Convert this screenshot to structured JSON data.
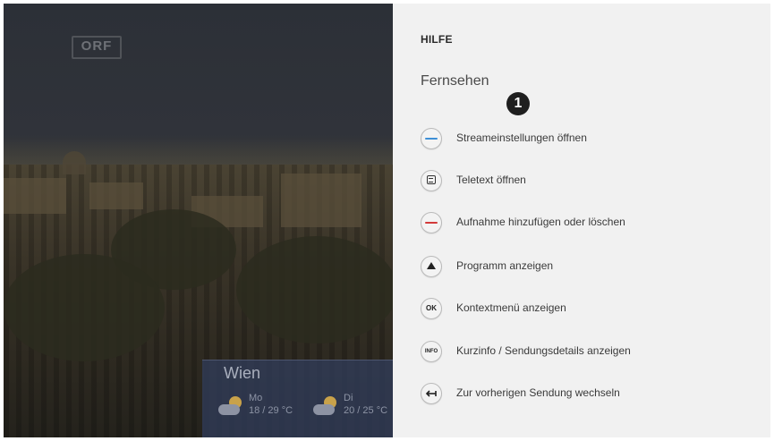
{
  "video": {
    "channel_logo": "ORF",
    "weather": {
      "city": "Wien",
      "forecast": [
        {
          "day": "Mo",
          "temp": "18 / 29 °C",
          "icon": "partly-cloudy-icon"
        },
        {
          "day": "Di",
          "temp": "20 / 25 °C",
          "icon": "partly-cloudy-icon"
        }
      ]
    }
  },
  "help_panel": {
    "title": "HILFE",
    "section": "Fernsehen",
    "marker": "1",
    "items": [
      {
        "icon": "blue-button-icon",
        "label": "Streameinstellungen öffnen"
      },
      {
        "icon": "teletext-icon",
        "label": "Teletext öffnen"
      },
      {
        "icon": "red-button-icon",
        "label": "Aufnahme hinzufügen oder löschen"
      },
      {
        "icon": "up-arrow-icon",
        "label": "Programm anzeigen"
      },
      {
        "icon": "ok-button-icon",
        "icon_text": "OK",
        "label": "Kontextmenü anzeigen"
      },
      {
        "icon": "info-button-icon",
        "icon_text": "INFO",
        "label": "Kurzinfo / Sendungsdetails anzeigen"
      },
      {
        "icon": "back-icon",
        "label": "Zur vorherigen Sendung wechseln"
      }
    ]
  },
  "colors": {
    "blue_key": "#3d8fd6",
    "red_key": "#d33a3a",
    "panel_bg": "#f1f1f1",
    "weather_bg": "#323e5c"
  }
}
